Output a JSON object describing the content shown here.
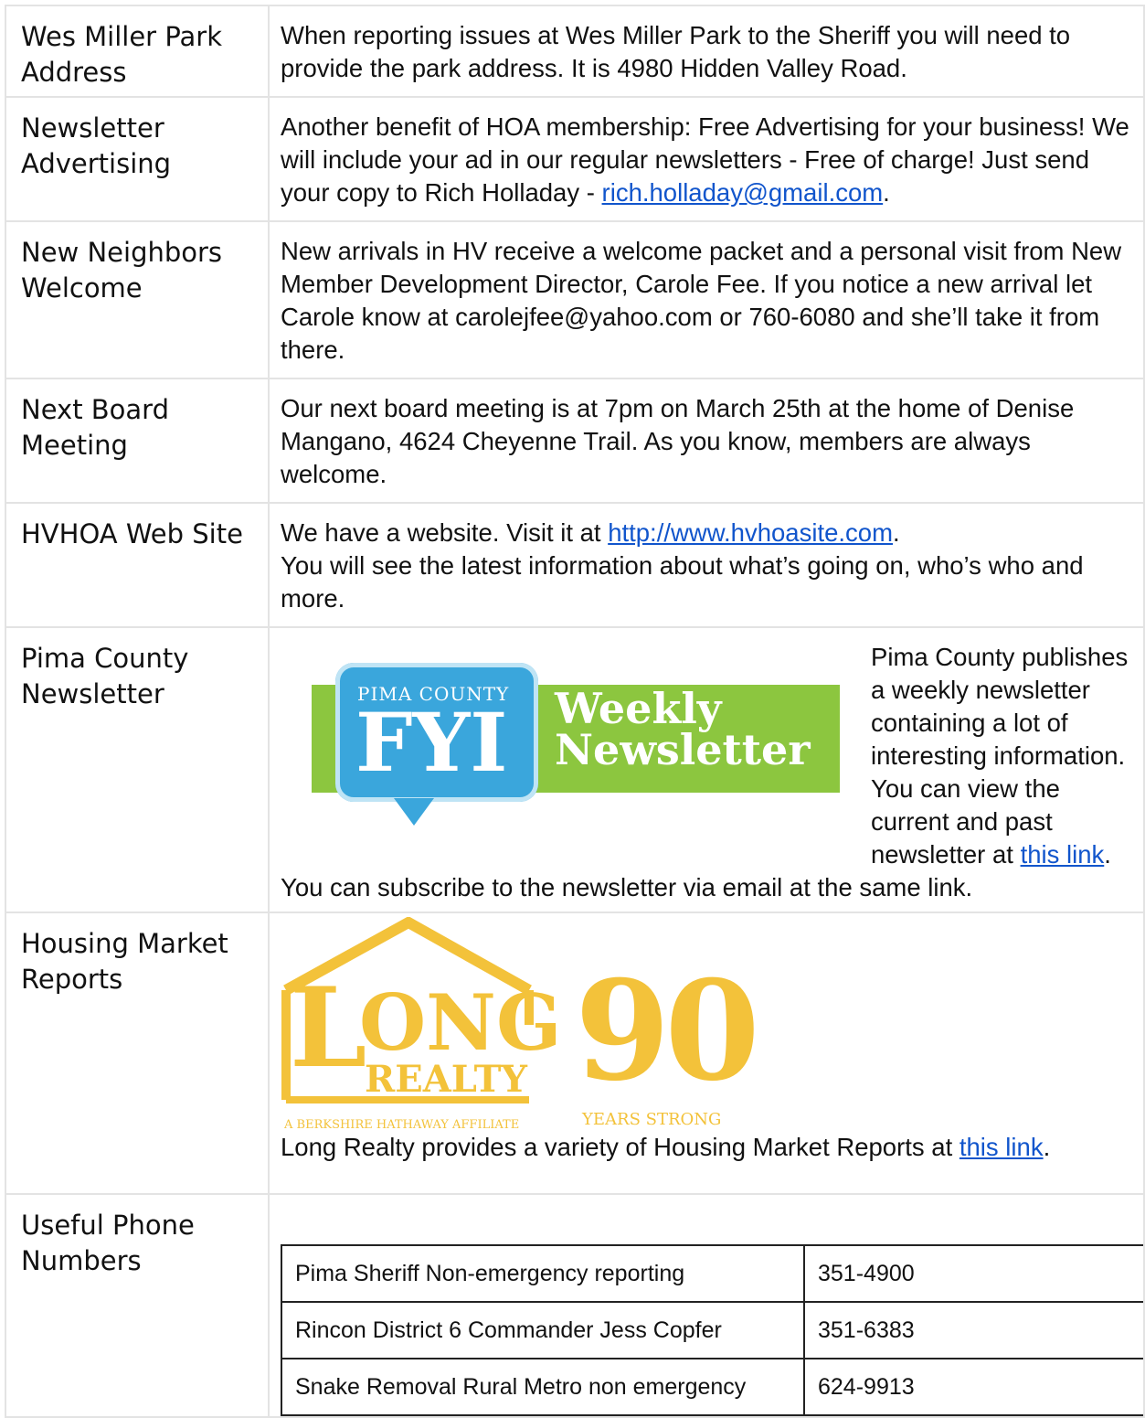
{
  "rows": [
    {
      "label": "Wes Miller Park Address",
      "text": "When reporting issues at Wes Miller Park to the Sheriff you will need to provide the park address. It is 4980 Hidden Valley Road."
    },
    {
      "label": "Newsletter Advertising",
      "text": "Another benefit of HOA membership: Free Advertising for your business! We will include your ad in our regular newsletters - Free of charge! Just send your copy to Rich Holladay - ",
      "link": "rich.holladay@gmail.com",
      "after": "."
    },
    {
      "label": "New Neighbors Welcome",
      "text": "New arrivals in HV receive a welcome packet and a personal visit from New Member Development Director, Carole Fee. If you notice a new arrival let Carole know at carolejfee@yahoo.com or 760-6080 and she’ll take it from there."
    },
    {
      "label": "Next Board Meeting",
      "text": "Our next board meeting is at 7pm on March 25th at the home of Denise Mangano, 4624 Cheyenne Trail.  As you know, members are always welcome."
    },
    {
      "label": "HVHOA Web Site",
      "text": "We have a website. Visit it at ",
      "link": "http://www.hvhoasite.com",
      "after": ".",
      "line2": "You will see the latest information about what’s going on, who’s who and more."
    },
    {
      "label": "Pima County Newsletter",
      "text": "Pima County publishes a weekly newsletter containing a lot of interesting information. You can view the current and past newsletter at ",
      "link": "this link",
      "after": ". You can subscribe to the newsletter via email at the same link."
    },
    {
      "label": "Housing Market Reports",
      "text": "Long Realty provides a variety of Housing Market Reports at ",
      "link": "this link",
      "after": "."
    },
    {
      "label": "Useful Phone Numbers"
    }
  ],
  "fyi_banner": {
    "small": "PIMA COUNTY",
    "big": "FYI",
    "line1": "Weekly",
    "line2": "Newsletter"
  },
  "long_realty_logo": {
    "l": "L",
    "ong": "ONG",
    "realty": "REALTY",
    "affiliate": "A BERKSHIRE HATHAWAY AFFILIATE",
    "ninety": "90",
    "years": "YEARS STRONG"
  },
  "phones": [
    {
      "name": "Pima Sheriff Non-emergency reporting",
      "number": "351-4900"
    },
    {
      "name": "Rincon District 6 Commander Jess Copfer",
      "number": "351-6383"
    },
    {
      "name": "Snake Removal Rural Metro non emergency",
      "number": "624-9913"
    }
  ],
  "colors": {
    "link": "#1155cc",
    "border": "#e3e3e3",
    "fyi_green": "#8cc63f",
    "fyi_blue": "#3aa6dc",
    "realty_gold": "#f3c23a"
  }
}
